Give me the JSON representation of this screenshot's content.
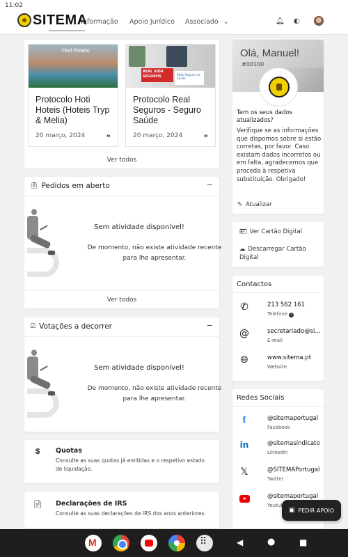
{
  "status_bar": {
    "time": "11:02"
  },
  "header": {
    "brand": "SITEMA",
    "nav": [
      "Informação",
      "Apoio Jurídico",
      "Associado"
    ],
    "icons": [
      "bell-icon",
      "theme-toggle-icon",
      "user-avatar"
    ]
  },
  "news": {
    "items": [
      {
        "title": "Protocolo Hoti Hoteis (Hoteis Tryp & Melia)",
        "date": "20 março, 2024",
        "image_text": "Hoti Hotels"
      },
      {
        "title": "Protocolo Real Seguros - Seguro Saúde",
        "date": "20 março, 2024",
        "image_text": "REAL VIDA SEGUROS",
        "image_logo": "REAL Seguros de Saúde"
      }
    ],
    "see_all": "Ver todos"
  },
  "requests": {
    "title": "Pedidos em aberto",
    "empty_title": "Sem atividade disponível!",
    "empty_text": "De momento, não existe atividade recente para lhe apresentar.",
    "see_all": "Ver todos"
  },
  "votes": {
    "title": "Votações a decorrer",
    "empty_title": "Sem atividade disponível!",
    "empty_text": "De momento, não existe atividade recente para lhe apresentar."
  },
  "quotas": {
    "title": "Quotas",
    "desc": "Consulte as suas quotas já emitidas e o respetivo estado de liquidação."
  },
  "irs": {
    "title": "Declarações de IRS",
    "desc": "Consulte as suas declarações de IRS dos anos anteriores."
  },
  "profile": {
    "greeting": "Olá, Manuel!",
    "member_number": "#00100",
    "question": "Tem os seus dados atualizados?",
    "text": "Verifique se as informações que dispomos sobre si estão corretas, por favor. Caso existam dados incorretos ou em falta, agradecemos que proceda à respetiva substituição. Obrigado!",
    "update": "Atualizar"
  },
  "card_links": {
    "view": "Ver Cartão Digital",
    "download": "Descarregar Cartão Digital"
  },
  "contacts": {
    "title": "Contactos",
    "items": [
      {
        "icon": "phone-icon",
        "value": "213 562 161",
        "label": "Telefone"
      },
      {
        "icon": "at-icon",
        "value": "secretariado@sitema.pt",
        "label": "E-mail"
      },
      {
        "icon": "globe-icon",
        "value": "www.sitema.pt",
        "label": "Website"
      }
    ]
  },
  "social": {
    "title": "Redes Sociais",
    "items": [
      {
        "icon": "facebook-icon",
        "value": "@sitemaportugal",
        "label": "Facebook"
      },
      {
        "icon": "linkedin-icon",
        "value": "@sitemasindicato",
        "label": "LinkedIn"
      },
      {
        "icon": "x-icon",
        "value": "@SITEMAPortugal",
        "label": "Twitter"
      },
      {
        "icon": "youtube-icon",
        "value": "@sitemaportugal",
        "label": "Youtube"
      }
    ]
  },
  "support_button": "PEDIR APOIO"
}
